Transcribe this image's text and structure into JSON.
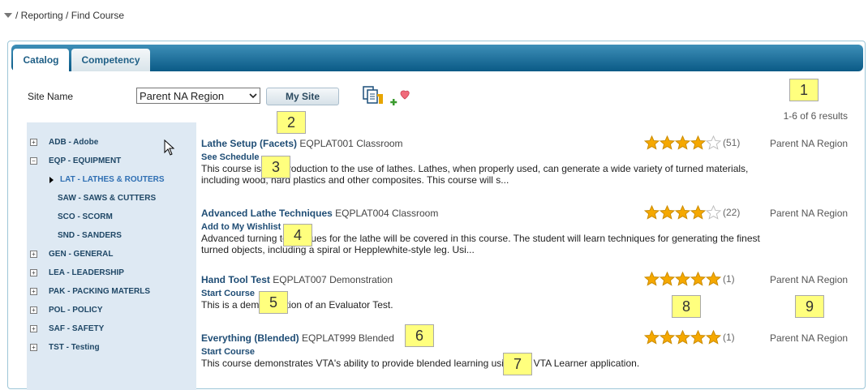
{
  "breadcrumb": "/ Reporting / Find Course",
  "tabs": [
    {
      "label": "Catalog"
    },
    {
      "label": "Competency"
    }
  ],
  "site": {
    "label": "Site Name",
    "selected": "Parent NA Region",
    "my_site_label": "My Site"
  },
  "results_text": "1-6 of 6 results",
  "sidebar": {
    "categories": [
      {
        "label": "ADB - Adobe",
        "toggle": "+"
      },
      {
        "label": "EQP - EQUIPMENT",
        "toggle": "−"
      },
      {
        "label": "GEN - GENERAL",
        "toggle": "+"
      },
      {
        "label": "LEA - LEADERSHIP",
        "toggle": "+"
      },
      {
        "label": "PAK - PACKING MATERLS",
        "toggle": "+"
      },
      {
        "label": "POL - POLICY",
        "toggle": "+"
      },
      {
        "label": "SAF - SAFETY",
        "toggle": "+"
      },
      {
        "label": "TST - Testing",
        "toggle": "+"
      }
    ],
    "subcategories": [
      {
        "label": "LAT - LATHES & ROUTERS"
      },
      {
        "label": "SAW - SAWS & CUTTERS"
      },
      {
        "label": "SCO - SCORM"
      },
      {
        "label": "SND - SANDERS"
      }
    ]
  },
  "courses": [
    {
      "name": "Lathe Setup (Facets)",
      "code": "EQPLAT001",
      "type": "Classroom",
      "action": "See Schedule",
      "description": "This course is an introduction to the use of lathes. Lathes, when properly used, can generate a wide variety of turned materials, including wood, hard plastics and other composites. This course will s...",
      "rating": 4,
      "rating_count": "(51)",
      "region": "Parent NA Region"
    },
    {
      "name": "Advanced Lathe Techniques",
      "code": "EQPLAT004",
      "type": "Classroom",
      "action": "Add to My Wishlist",
      "description": "Advanced turning techniques for the lathe will be covered in this course. The student will learn techniques for generating the finest turned objects, including a spiral or Hepplewhite-style leg. Usi...",
      "rating": 4,
      "rating_count": "(22)",
      "region": "Parent NA Region"
    },
    {
      "name": "Hand Tool Test",
      "code": "EQPLAT007",
      "type": "Demonstration",
      "action": "Start Course",
      "description": "This is a demonstration of an Evaluator Test.",
      "rating": 5,
      "rating_count": "(1)",
      "region": "Parent NA Region"
    },
    {
      "name": "Everything (Blended)",
      "code": "EQPLAT999",
      "type": "Blended",
      "action": "Start Course",
      "description": "This course  demonstrates VTA's ability to provide blended learning using the VTA Learner application.",
      "rating": 5,
      "rating_count": "(1)",
      "region": "Parent NA Region"
    }
  ],
  "markers": [
    "1",
    "2",
    "3",
    "4",
    "5",
    "6",
    "7",
    "8",
    "9"
  ],
  "colors": {
    "star_on": "#f5a800",
    "star_off": "#ffffff",
    "tab_bar": "#0a5a86",
    "marker_bg": "#ffff7e"
  }
}
